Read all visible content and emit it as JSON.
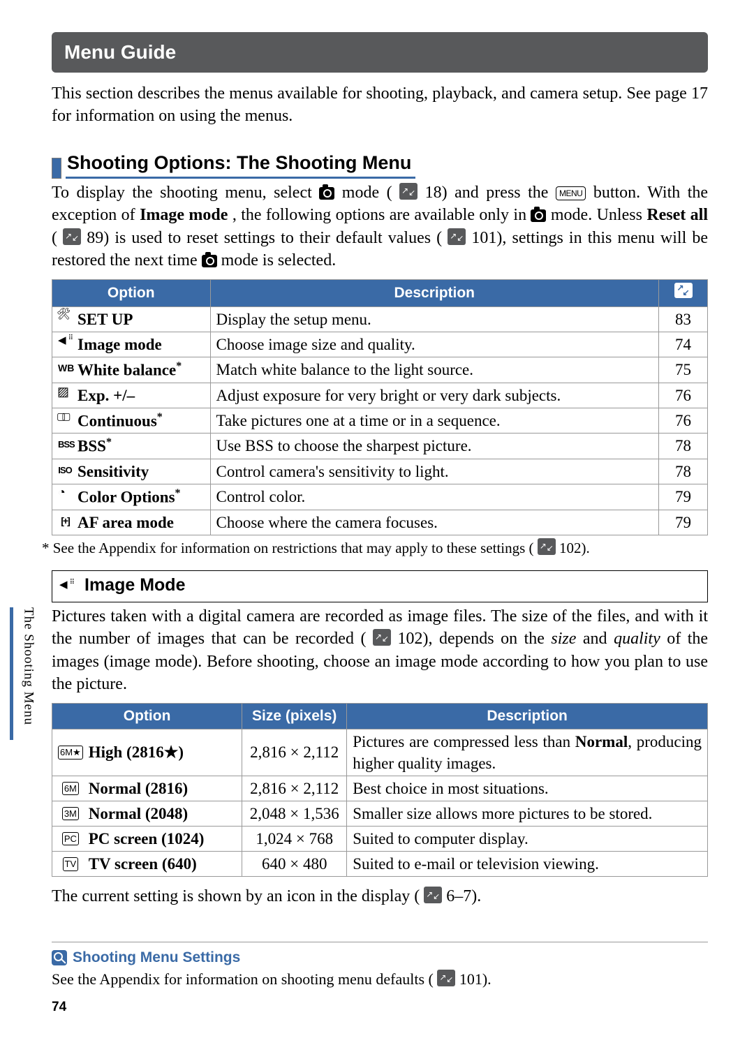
{
  "header": {
    "title": "Menu Guide"
  },
  "intro": "This section describes the menus available for shooting, playback, and camera setup.  See page 17 for information on using the menus.",
  "subsection1": {
    "title": "Shooting Options: The Shooting Menu",
    "body_parts": {
      "p1a": "To display the shooting menu, select ",
      "p1b": " mode (",
      "p1c": " 18) and press the ",
      "menu_label": "MENU",
      "p1d": " button. With the exception of ",
      "bold1": "Image mode",
      "p1e": ", the following options are available only in ",
      "p1f": " mode.  Unless ",
      "bold2": "Reset all",
      "p1g": " (",
      "p1h": " 89) is used to reset settings to their default values (",
      "p1i": " 101), settings in this menu will be restored the next time ",
      "p1j": " mode is selected."
    },
    "table": {
      "headers": {
        "option": "Option",
        "description": "Description"
      },
      "rows": [
        {
          "icon": "wrench",
          "name": "SET UP",
          "star": false,
          "desc": "Display the setup menu.",
          "page": "83"
        },
        {
          "icon": "arrow-in",
          "name": "Image mode",
          "star": false,
          "desc": "Choose image size and quality.",
          "page": "74"
        },
        {
          "icon": "wb",
          "name": "White balance",
          "star": true,
          "desc": "Match white balance to the light source.",
          "page": "75"
        },
        {
          "icon": "exp",
          "name": "Exp. +/–",
          "star": false,
          "desc": "Adjust exposure for very bright or very dark subjects.",
          "page": "76"
        },
        {
          "icon": "cont",
          "name": "Continuous",
          "star": true,
          "desc": "Take pictures one at a time or in a sequence.",
          "page": "76"
        },
        {
          "icon": "bss",
          "name": "BSS",
          "star": true,
          "desc": "Use BSS to choose the sharpest picture.",
          "page": "78"
        },
        {
          "icon": "iso",
          "name": "Sensitivity",
          "star": false,
          "desc": "Control camera's sensitivity to light.",
          "page": "78"
        },
        {
          "icon": "palette",
          "name": "Color Options",
          "star": true,
          "desc": "Control color.",
          "page": "79"
        },
        {
          "icon": "af",
          "name": "AF area mode",
          "star": false,
          "desc": "Choose where the camera focuses.",
          "page": "79"
        }
      ]
    },
    "footnote_a": "* See the Appendix for information on restrictions that may apply to these settings (",
    "footnote_b": " 102)."
  },
  "image_mode": {
    "heading": "Image Mode",
    "body": {
      "p1a": "Pictures taken with a digital camera are recorded as image files.  The size of the files, and with it the number of images that can be recorded (",
      "p1b": " 102), depends on the ",
      "it1": "size",
      "p1c": " and ",
      "it2": "quality",
      "p1d": " of the images (image mode).  Before shooting, choose an image mode according to how you plan to use the picture."
    },
    "table": {
      "headers": {
        "option": "Option",
        "size": "Size (pixels)",
        "description": "Description"
      },
      "rows": [
        {
          "badge": "6M★",
          "name": "High (2816★)",
          "size": "2,816 × 2,112",
          "desc_a": "Pictures are compressed less than ",
          "desc_bold": "Normal",
          "desc_b": ", producing higher quality images."
        },
        {
          "badge": "6M",
          "name": "Normal (2816)",
          "size": "2,816 × 2,112",
          "desc": "Best choice in most situations."
        },
        {
          "badge": "3M",
          "name": "Normal (2048)",
          "size": "2,048 × 1,536",
          "desc": "Smaller size allows more pictures to be stored."
        },
        {
          "badge": "PC",
          "name": "PC screen (1024)",
          "size": "1,024 × 768",
          "desc": "Suited to computer display."
        },
        {
          "badge": "TV",
          "name": "TV screen (640)",
          "size": "640 × 480",
          "desc": "Suited to e-mail or television viewing."
        }
      ]
    },
    "tail_a": "The current setting is shown by an icon in the display (",
    "tail_b": " 6–7)."
  },
  "note": {
    "title": "Shooting Menu Settings",
    "body_a": "See the Appendix for information on shooting menu defaults (",
    "body_b": " 101)."
  },
  "side_label": "The Shooting Menu",
  "page_number": "74"
}
